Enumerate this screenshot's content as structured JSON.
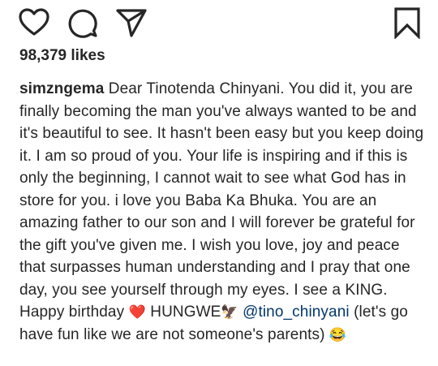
{
  "actions": {
    "like_icon": "heart-outline",
    "comment_icon": "speech-bubble",
    "share_icon": "paper-plane",
    "save_icon": "bookmark"
  },
  "likes": "98,379 likes",
  "caption": {
    "username": "simzngema",
    "text_before_heart": "Dear Tinotenda Chinyani. You did it, you are finally becoming the man you've always wanted to be and it's beautiful to see. It hasn't been easy but you keep doing it. I am so proud of you. Your life is inspiring and if this is only the beginning, I cannot wait to see what God has in store for you. i love you Baba Ka Bhuka. You are an amazing father to our son and I will forever be grateful for the gift you've given me. I wish you love, joy and peace that surpasses human understanding and I pray that one day, you see yourself through my eyes. I see a KING. Happy birthday",
    "heart_emoji": "❤️",
    "hungwe": "HUNGWE",
    "eagle_emoji": "🦅",
    "mention": "@tino_chinyani",
    "text_after_mention": "(let's go have fun like we are not someone's parents)",
    "laugh_emoji": "😂"
  }
}
